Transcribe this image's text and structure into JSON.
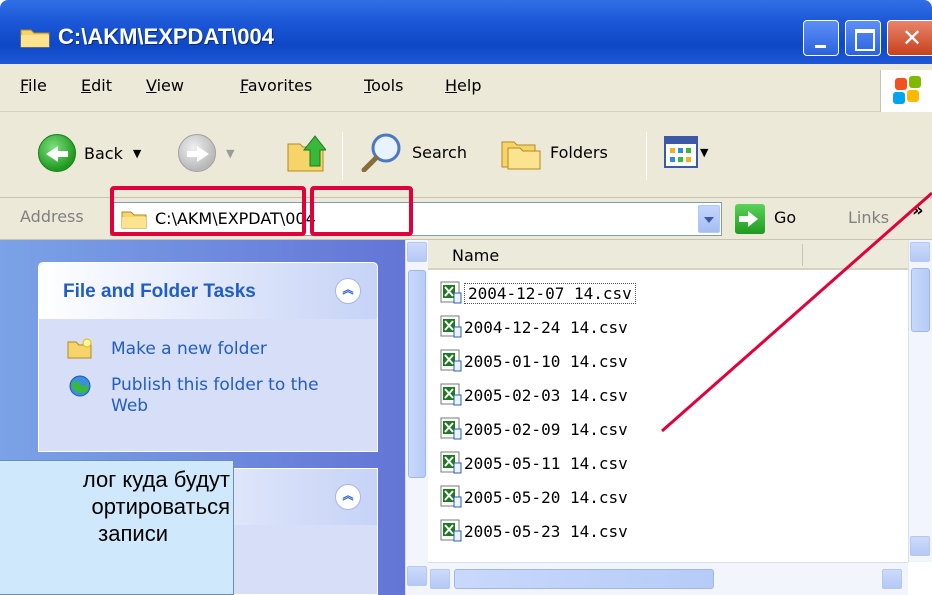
{
  "window": {
    "title": "C:\\AKM\\EXPDAT\\004",
    "close_glyph": "✕"
  },
  "menu": {
    "items": [
      "File",
      "Edit",
      "View",
      "Favorites",
      "Tools",
      "Help"
    ]
  },
  "toolbar": {
    "back_label": "Back",
    "search_label": "Search",
    "folders_label": "Folders",
    "dropdown_glyph": "▼"
  },
  "address": {
    "label": "Address",
    "value": "C:\\AKM\\EXPDAT\\004",
    "go_label": "Go",
    "links_label": "Links",
    "links_more": "»"
  },
  "left_pane": {
    "tasks_title": "File and Folder Tasks",
    "collapse_glyph": "︽",
    "task_links": [
      "Make a new folder",
      "Publish this folder to the Web"
    ]
  },
  "callout": {
    "text_lines": [
      "лог куда будут",
      "ортироваться",
      "записи"
    ]
  },
  "file_list": {
    "column_name": "Name",
    "files": [
      "2004-12-07 14.csv",
      "2004-12-24 14.csv",
      "2005-01-10 14.csv",
      "2005-02-03 14.csv",
      "2005-02-09 14.csv",
      "2005-05-11 14.csv",
      "2005-05-20 14.csv",
      "2005-05-23 14.csv"
    ],
    "focused_index": 0
  },
  "colors": {
    "titlebar": "#1b57d6",
    "task_text": "#215dc6",
    "annotation_red": "#e0003a",
    "callout_fill": "#cfe8fb",
    "excel_green": "#1e7a1e"
  },
  "icons": [
    "folder-icon",
    "back-arrow-icon",
    "forward-arrow-icon",
    "up-folder-icon",
    "search-icon",
    "folders-icon",
    "views-icon",
    "go-arrow-icon",
    "new-folder-icon",
    "publish-web-icon",
    "excel-csv-icon",
    "windows-logo-icon"
  ]
}
